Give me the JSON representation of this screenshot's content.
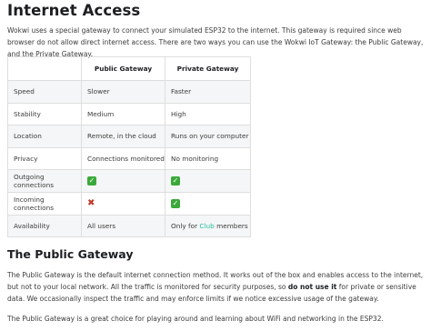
{
  "title": "Internet Access",
  "intro": "Wokwi uses a special gateway to connect your simulated ESP32 to the internet. This gateway is required since web browser do not allow direct internet access. There are two ways you can use the Wokwi IoT Gateway: the Public Gateway, and the Private Gateway.",
  "table": {
    "headers": [
      "",
      "Public Gateway",
      "Private Gateway"
    ],
    "rows": [
      {
        "label": "Speed",
        "public": "Slower",
        "private": "Faster"
      },
      {
        "label": "Stability",
        "public": "Medium",
        "private": "High"
      },
      {
        "label": "Location",
        "public": "Remote, in the cloud",
        "private": "Runs on your computer"
      },
      {
        "label": "Privacy",
        "public": "Connections monitored",
        "private": "No monitoring"
      },
      {
        "label": "Outgoing connections",
        "public_icon": "check-icon",
        "private_icon": "check-icon"
      },
      {
        "label": "Incoming connections",
        "public_icon": "cross-icon",
        "private_icon": "check-icon"
      },
      {
        "label": "Availability",
        "public": "All users",
        "private_prefix": "Only for ",
        "private_link": "Club",
        "private_suffix": " members"
      }
    ]
  },
  "section": {
    "heading": "The Public Gateway",
    "p1_before": "The Public Gateway is the default internet connection method. It works out of the box and enables access to the internet, but not to your local network. All the traffic is monitored for security purposes, so ",
    "p1_bold": "do not use it",
    "p1_after": " for private or sensitive data. We occasionally inspect the traffic and may enforce limits if we notice excessive usage of the gateway.",
    "p2": "The Public Gateway is a great choice for playing around and learning about WiFi and networking in the ESP32."
  },
  "colors": {
    "link": "#25c2a0",
    "check": "#3aa93a",
    "cross": "#c0392b"
  }
}
